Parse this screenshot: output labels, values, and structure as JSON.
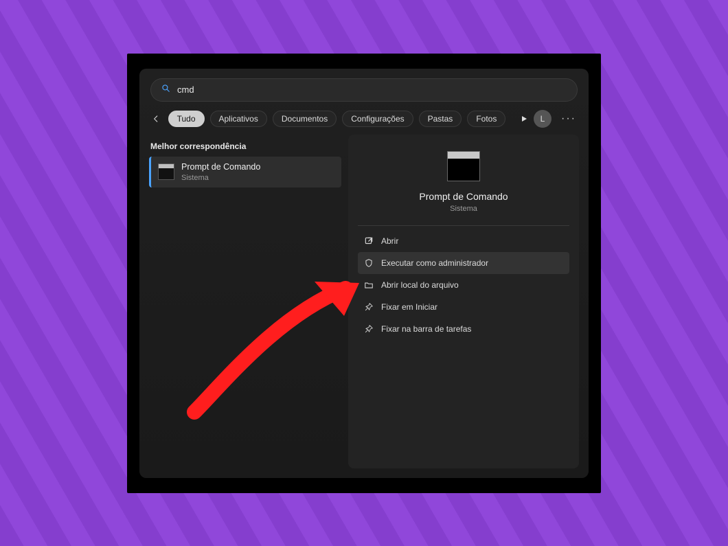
{
  "search": {
    "value": "cmd",
    "placeholder": ""
  },
  "tabs": {
    "active_index": 0,
    "items": [
      {
        "label": "Tudo"
      },
      {
        "label": "Aplicativos"
      },
      {
        "label": "Documentos"
      },
      {
        "label": "Configurações"
      },
      {
        "label": "Pastas"
      },
      {
        "label": "Fotos"
      }
    ]
  },
  "user": {
    "initial": "L"
  },
  "left": {
    "section_label": "Melhor correspondência",
    "result": {
      "title": "Prompt de Comando",
      "subtitle": "Sistema"
    }
  },
  "preview": {
    "title": "Prompt de Comando",
    "subtitle": "Sistema"
  },
  "actions": [
    {
      "icon": "open-external-icon",
      "label": "Abrir",
      "highlight": false
    },
    {
      "icon": "shield-admin-icon",
      "label": "Executar como administrador",
      "highlight": true
    },
    {
      "icon": "folder-icon",
      "label": "Abrir local do arquivo",
      "highlight": false
    },
    {
      "icon": "pin-icon",
      "label": "Fixar em Iniciar",
      "highlight": false
    },
    {
      "icon": "pin-icon",
      "label": "Fixar na barra de tarefas",
      "highlight": false
    }
  ],
  "annotation": {
    "arrow_color": "#ff1e1e",
    "target": "run-as-administrator-action"
  },
  "colors": {
    "page_bg": "#8c41d9",
    "window_bg": "#1e1e1e",
    "panel_bg": "#232323",
    "highlight_bg": "#333333",
    "text_primary": "#eaeaea",
    "text_secondary": "#9a9a9a",
    "chip_active_bg": "#cfcfcf"
  }
}
